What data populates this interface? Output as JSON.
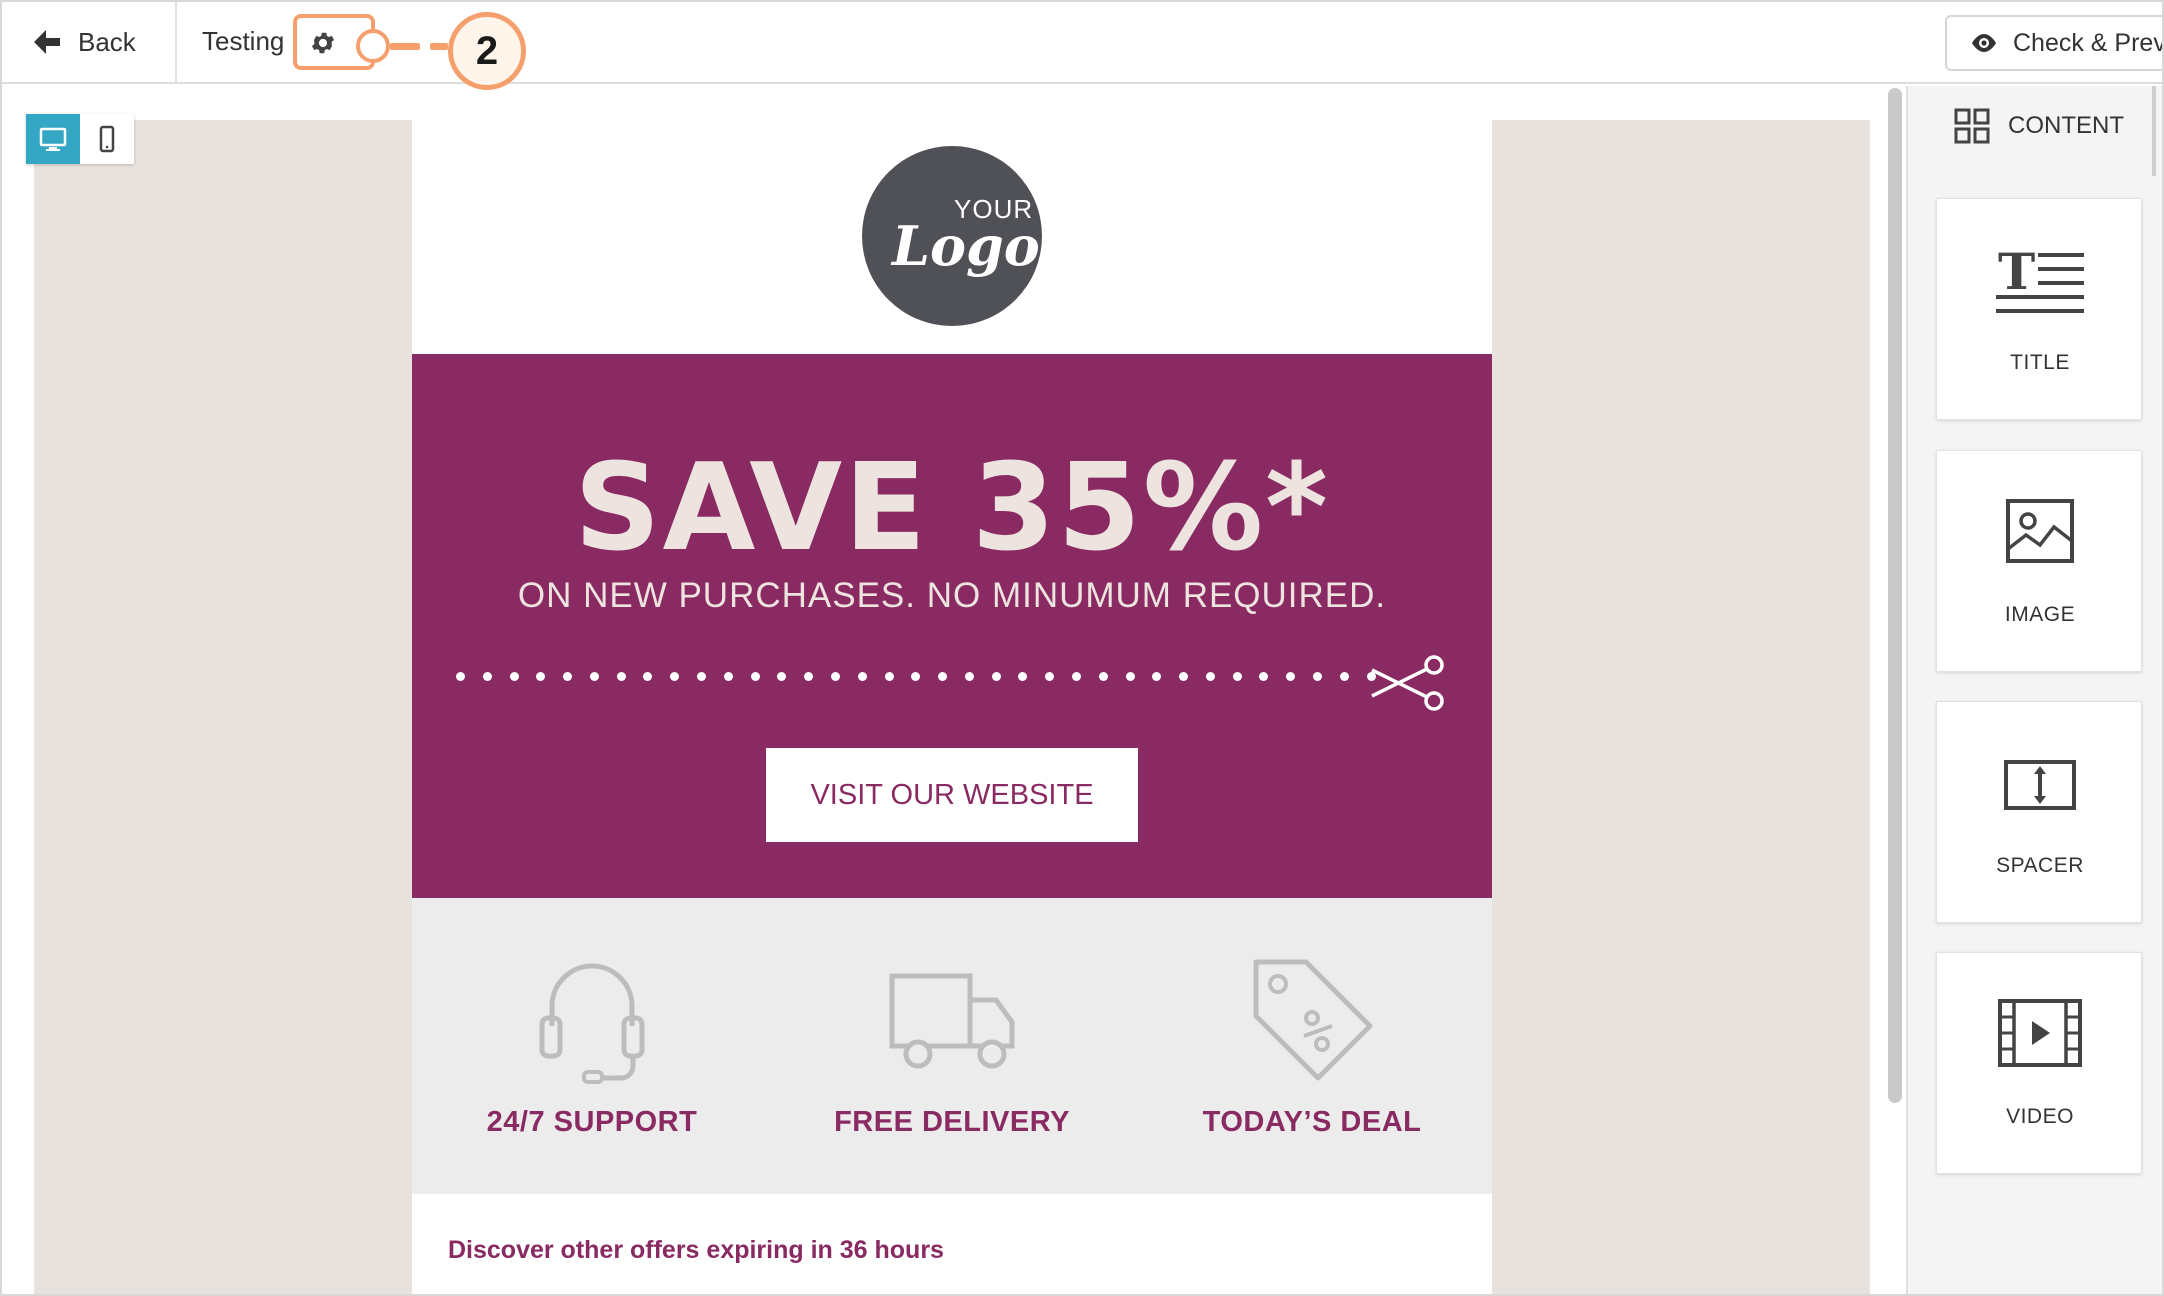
{
  "topbar": {
    "back_label": "Back",
    "title": "Testing",
    "step_number": "2",
    "check_preview_label": "Check & Preview"
  },
  "colors": {
    "accent": "#8a2a62",
    "highlight": "#f5a06c",
    "active_view": "#33a7c4"
  },
  "email": {
    "logo_your": "YOUR",
    "logo_logo": "Logo",
    "headline": "SAVE 35%*",
    "subheadline": "ON NEW PURCHASES. NO MINUMUM REQUIRED.",
    "cta": "VISIT OUR WEBSITE",
    "features": [
      {
        "label": "24/7 SUPPORT",
        "icon": "headset-icon"
      },
      {
        "label": "FREE DELIVERY",
        "icon": "truck-icon"
      },
      {
        "label": "TODAY’S DEAL",
        "icon": "tag-icon"
      }
    ],
    "offers_text": "Discover other offers expiring in 36 hours"
  },
  "panel": {
    "tab_label": "CONTENT",
    "blocks": [
      {
        "label": "TITLE",
        "icon": "title-icon"
      },
      {
        "label": "IMAGE",
        "icon": "image-icon"
      },
      {
        "label": "SPACER",
        "icon": "spacer-icon"
      },
      {
        "label": "VIDEO",
        "icon": "video-icon"
      }
    ]
  }
}
